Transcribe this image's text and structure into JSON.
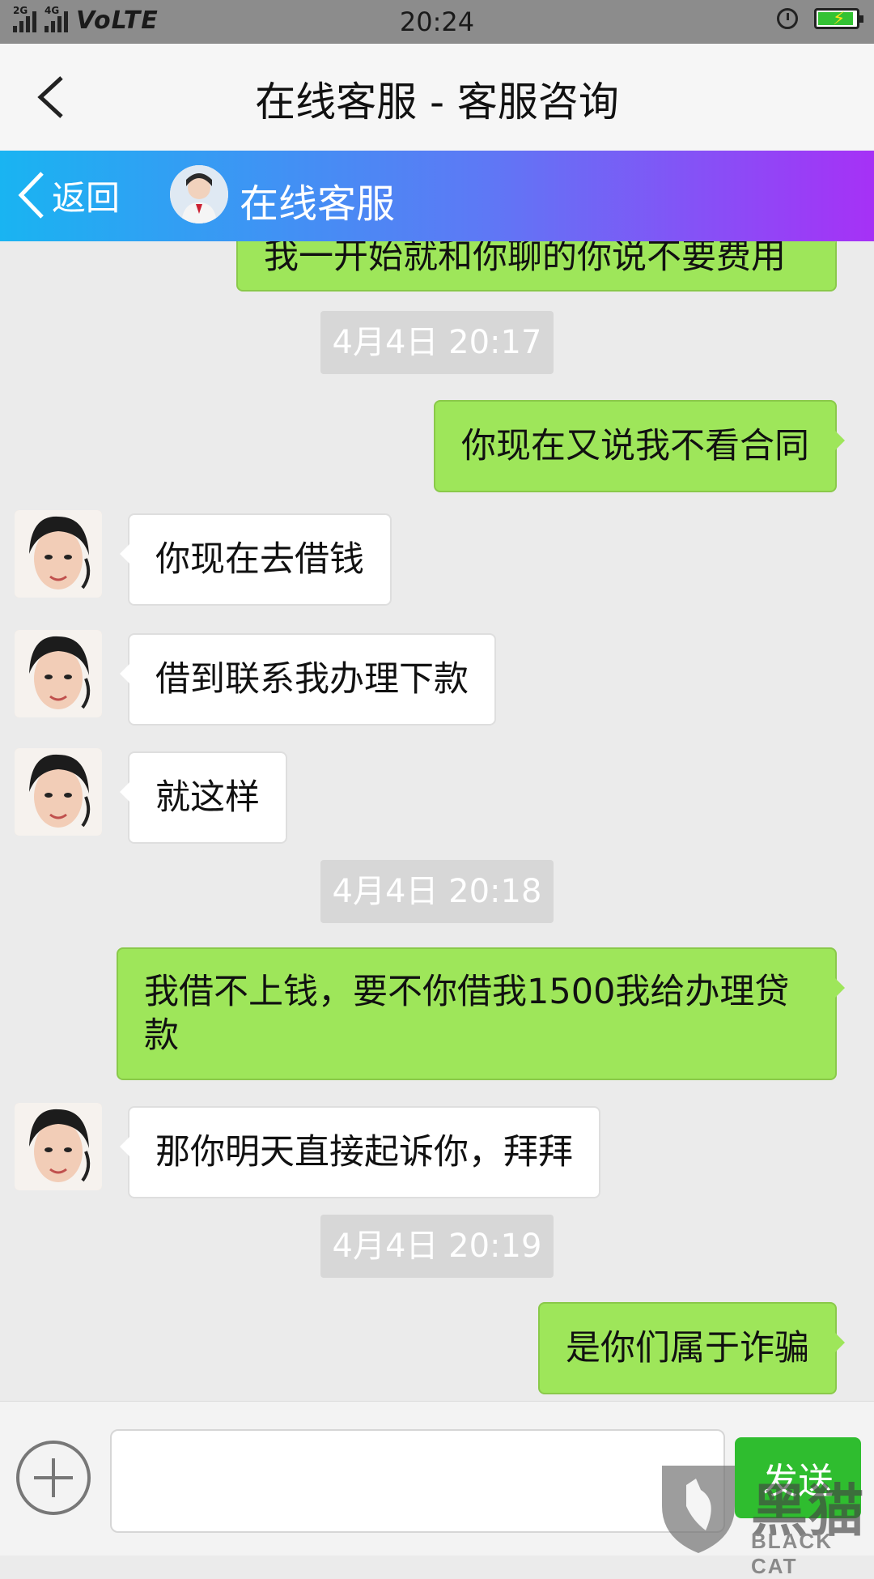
{
  "status_bar": {
    "network_small_1": "2G",
    "network_small_2": "4G",
    "volte": "VoLTE",
    "time": "20:24"
  },
  "title_bar": {
    "title": "在线客服 - 客服咨询"
  },
  "chat_header": {
    "back_label": "返回",
    "agent_name": "在线客服"
  },
  "messages": [
    {
      "type": "sent",
      "text": "我一开始就和你聊的你说不要费用"
    },
    {
      "type": "timestamp",
      "text": "4月4日 20:17"
    },
    {
      "type": "sent",
      "text": "你现在又说我不看合同"
    },
    {
      "type": "received",
      "text": "你现在去借钱"
    },
    {
      "type": "received",
      "text": "借到联系我办理下款"
    },
    {
      "type": "received",
      "text": "就这样"
    },
    {
      "type": "timestamp",
      "text": "4月4日 20:18"
    },
    {
      "type": "sent",
      "text": "我借不上钱，要不你借我1500我给办理贷款"
    },
    {
      "type": "received",
      "text": "那你明天直接起诉你，拜拜"
    },
    {
      "type": "timestamp",
      "text": "4月4日 20:19"
    },
    {
      "type": "sent",
      "text": "是你们属于诈骗"
    }
  ],
  "input_bar": {
    "input_value": "",
    "send_label": "发送"
  },
  "watermark": {
    "brand_cn": "黑猫",
    "brand_en": "BLACK CAT"
  },
  "colors": {
    "sent_bubble": "#9ee65a",
    "received_bubble": "#ffffff",
    "header_gradient_start": "#19b4f2",
    "header_gradient_end": "#a631f6",
    "send_button": "#2fbd2f"
  }
}
